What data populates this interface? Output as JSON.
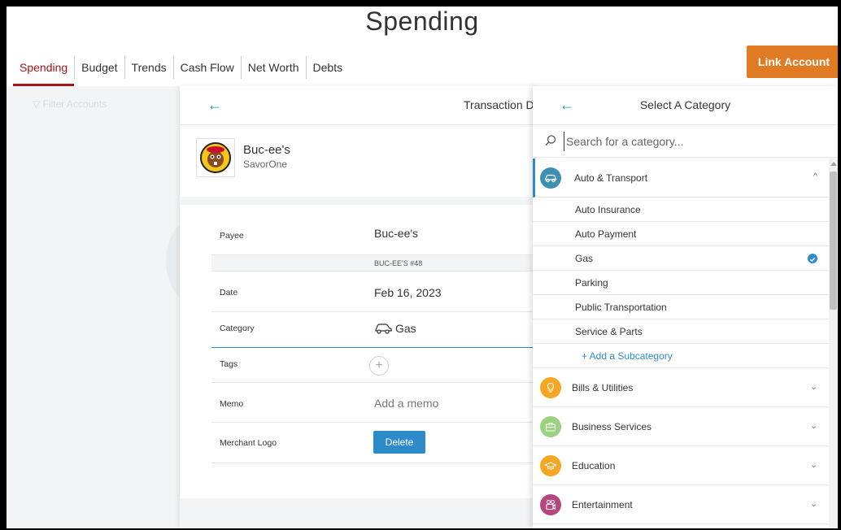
{
  "page_title": "Spending",
  "tabs": [
    {
      "label": "Spending"
    },
    {
      "label": "Budget"
    },
    {
      "label": "Trends"
    },
    {
      "label": "Cash Flow"
    },
    {
      "label": "Net Worth"
    },
    {
      "label": "Debts"
    }
  ],
  "link_account_label": "Link Account",
  "filter_accounts_label": "Filter Accounts",
  "detail": {
    "title": "Transaction D",
    "merchant_name": "Buc-ee's",
    "merchant_sub": "SavorOne",
    "fields": {
      "payee_label": "Payee",
      "payee_value": "Buc-ee's",
      "payee_raw": "BUC-EE'S #48",
      "date_label": "Date",
      "date_value": "Feb 16, 2023",
      "category_label": "Category",
      "category_value": "Gas",
      "tags_label": "Tags",
      "tags_add": "+",
      "memo_label": "Memo",
      "memo_placeholder": "Add a memo",
      "logo_label": "Merchant Logo",
      "delete_label": "Delete"
    }
  },
  "category_panel": {
    "title": "Select A Category",
    "search_placeholder": "Search for a category...",
    "groups": [
      {
        "label": "Auto & Transport",
        "color": "#3f8fb5",
        "icon": "car-icon",
        "expanded": true,
        "subcategories": [
          {
            "label": "Auto Insurance",
            "selected": false
          },
          {
            "label": "Auto Payment",
            "selected": false
          },
          {
            "label": "Gas",
            "selected": true
          },
          {
            "label": "Parking",
            "selected": false
          },
          {
            "label": "Public Transportation",
            "selected": false
          },
          {
            "label": "Service & Parts",
            "selected": false
          }
        ],
        "add_subcategory_label": "+ Add a Subcategory"
      },
      {
        "label": "Bills & Utilities",
        "color": "#f5a623",
        "icon": "lightbulb-icon"
      },
      {
        "label": "Business Services",
        "color": "#9bd17f",
        "icon": "briefcase-icon"
      },
      {
        "label": "Education",
        "color": "#f5a623",
        "icon": "graduation-cap-icon"
      },
      {
        "label": "Entertainment",
        "color": "#b5477e",
        "icon": "film-camera-icon"
      }
    ]
  },
  "colors": {
    "accent_blue": "#2e8bc9",
    "brand_red": "#a0161a",
    "link_account_orange": "#e07b24"
  }
}
